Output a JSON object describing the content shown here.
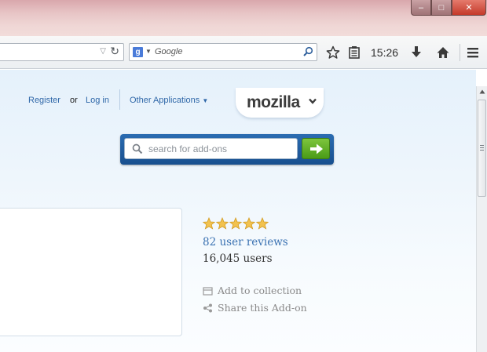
{
  "browser": {
    "window_controls": {
      "minimize": "–",
      "maximize": "□",
      "close": "✕"
    },
    "search_engine": "Google",
    "clock": "15:26",
    "icons": [
      "bookmark-star-icon",
      "reading-list-icon",
      "download-icon",
      "home-icon",
      "menu-icon",
      "reload-icon"
    ]
  },
  "header": {
    "register": "Register",
    "or": "or",
    "login": "Log in",
    "other_apps": "Other Applications",
    "brand": "mozilla"
  },
  "search": {
    "placeholder": "search for add-ons"
  },
  "addon": {
    "rating": 5,
    "reviews": "82 user reviews",
    "users": "16,045 users",
    "add_to_collection": "Add to collection",
    "share": "Share this Add-on"
  },
  "colors": {
    "link": "#3a72b2",
    "star": "#f2c24f",
    "go_button": "#5aab22",
    "search_frame": "#1f5c9f"
  }
}
